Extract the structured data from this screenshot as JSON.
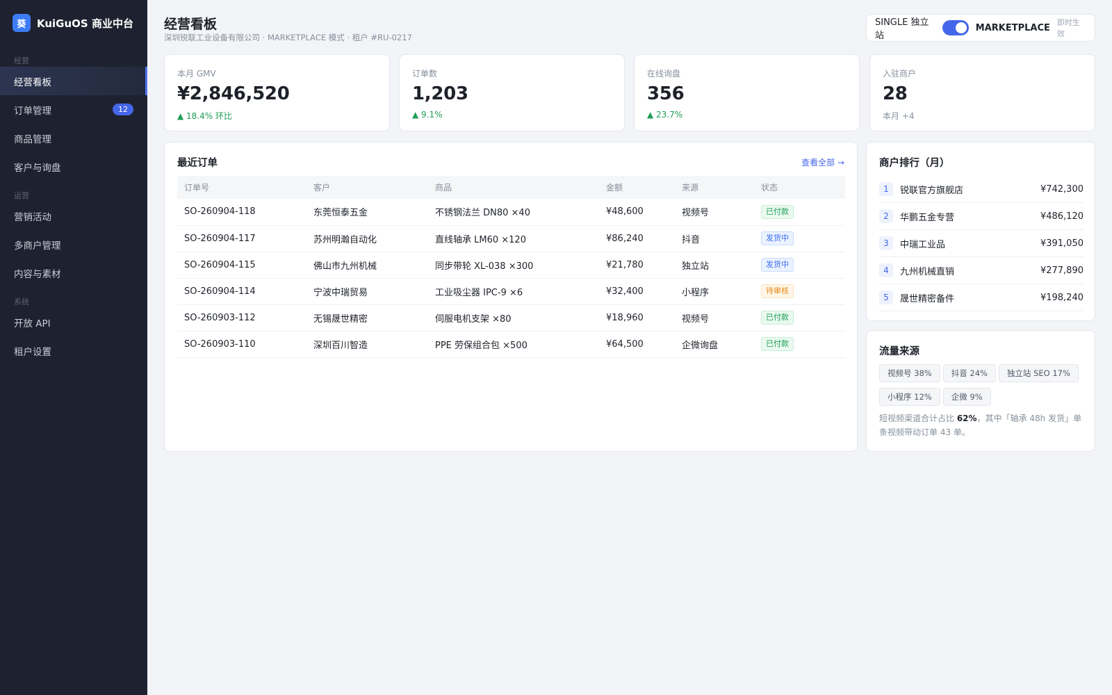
{
  "brand": {
    "logo_char": "葵",
    "name": "KuiGuOS 商业中台"
  },
  "sidebar": {
    "sections": [
      {
        "label": "经营",
        "items": [
          {
            "label": "经营看板",
            "active": true
          },
          {
            "label": "订单管理",
            "badge": "12"
          },
          {
            "label": "商品管理"
          },
          {
            "label": "客户与询盘"
          }
        ]
      },
      {
        "label": "运营",
        "items": [
          {
            "label": "营销活动"
          },
          {
            "label": "多商户管理"
          },
          {
            "label": "内容与素材"
          }
        ]
      },
      {
        "label": "系统",
        "items": [
          {
            "label": "开放 API"
          },
          {
            "label": "租户设置"
          }
        ]
      }
    ]
  },
  "header": {
    "title": "经营看板",
    "subtitle": "深圳锐联工业设备有限公司 · MARKETPLACE 模式 · 租户 #RU-0217",
    "mode_single": "SINGLE 独立站",
    "mode_marketplace": "MARKETPLACE",
    "mode_note": "即时生效",
    "toggle_on": true
  },
  "kpis": [
    {
      "label": "本月 GMV",
      "value": "¥2,846,520",
      "delta": "▲ 18.4% 环比",
      "trend": "up"
    },
    {
      "label": "订单数",
      "value": "1,203",
      "delta": "▲ 9.1%",
      "trend": "up"
    },
    {
      "label": "在线询盘",
      "value": "356",
      "delta": "▲ 23.7%",
      "trend": "up"
    },
    {
      "label": "入驻商户",
      "value": "28",
      "delta": "本月 +4",
      "trend": "neutral"
    }
  ],
  "orders": {
    "title": "最近订单",
    "view_all": "查看全部 →",
    "columns": [
      "订单号",
      "客户",
      "商品",
      "金额",
      "来源",
      "状态"
    ],
    "rows": [
      {
        "id": "SO-260904-118",
        "customer": "东莞恒泰五金",
        "product": "不锈钢法兰 DN80 ×40",
        "amount": "¥48,600",
        "source": "视频号",
        "status": "已付款",
        "status_type": "paid"
      },
      {
        "id": "SO-260904-117",
        "customer": "苏州明瀚自动化",
        "product": "直线轴承 LM60 ×120",
        "amount": "¥86,240",
        "source": "抖音",
        "status": "发货中",
        "status_type": "ship"
      },
      {
        "id": "SO-260904-115",
        "customer": "佛山市九州机械",
        "product": "同步带轮 XL-038 ×300",
        "amount": "¥21,780",
        "source": "独立站",
        "status": "发货中",
        "status_type": "ship"
      },
      {
        "id": "SO-260904-114",
        "customer": "宁波中瑞贸易",
        "product": "工业吸尘器 IPC-9 ×6",
        "amount": "¥32,400",
        "source": "小程序",
        "status": "待审核",
        "status_type": "review"
      },
      {
        "id": "SO-260903-112",
        "customer": "无锡晟世精密",
        "product": "伺服电机支架 ×80",
        "amount": "¥18,960",
        "source": "视频号",
        "status": "已付款",
        "status_type": "paid"
      },
      {
        "id": "SO-260903-110",
        "customer": "深圳百川智造",
        "product": "PPE 劳保组合包 ×500",
        "amount": "¥64,500",
        "source": "企微询盘",
        "status": "已付款",
        "status_type": "paid"
      }
    ]
  },
  "ranking": {
    "title": "商户排行（月）",
    "items": [
      {
        "rank": "1",
        "name": "锐联官方旗舰店",
        "value": "¥742,300"
      },
      {
        "rank": "2",
        "name": "华鹏五金专营",
        "value": "¥486,120"
      },
      {
        "rank": "3",
        "name": "中瑞工业品",
        "value": "¥391,050"
      },
      {
        "rank": "4",
        "name": "九州机械直销",
        "value": "¥277,890"
      },
      {
        "rank": "5",
        "name": "晟世精密备件",
        "value": "¥198,240"
      }
    ]
  },
  "traffic": {
    "title": "流量来源",
    "tags": [
      "视频号 38%",
      "抖音 24%",
      "独立站 SEO 17%",
      "小程序 12%",
      "企微 9%"
    ],
    "note_prefix": "短视频渠道合计占比 ",
    "note_highlight": "62%",
    "note_suffix": "，其中「轴承 48h 发货」单条视频带动订单 43 单。"
  }
}
